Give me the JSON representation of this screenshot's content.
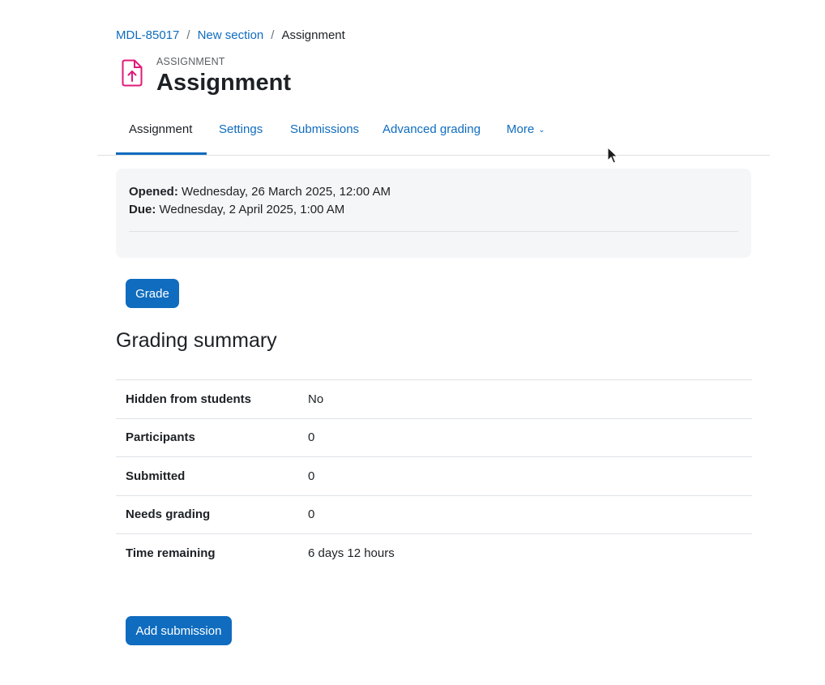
{
  "breadcrumb": {
    "items": [
      "MDL-85017",
      "New section"
    ],
    "current": "Assignment",
    "separator": "/"
  },
  "header": {
    "pretitle": "ASSIGNMENT",
    "title": "Assignment",
    "icon": "assignment-upload-icon",
    "icon_color": "#e1197a"
  },
  "tabs": [
    {
      "label": "Assignment",
      "active": true
    },
    {
      "label": "Settings"
    },
    {
      "label": "Submissions"
    },
    {
      "label": "Advanced grading"
    },
    {
      "label": "More"
    }
  ],
  "dates": {
    "opened_label": "Opened:",
    "opened_value": "Wednesday, 26 March 2025, 12:00 AM",
    "due_label": "Due:",
    "due_value": "Wednesday, 2 April 2025, 1:00 AM"
  },
  "buttons": {
    "grade": "Grade",
    "add_submission": "Add submission"
  },
  "grading_summary": {
    "title": "Grading summary",
    "rows": [
      {
        "label": "Hidden from students",
        "value": "No"
      },
      {
        "label": "Participants",
        "value": "0"
      },
      {
        "label": "Submitted",
        "value": "0"
      },
      {
        "label": "Needs grading",
        "value": "0"
      },
      {
        "label": "Time remaining",
        "value": "6 days 12 hours"
      }
    ]
  },
  "colors": {
    "primary": "#0f6cbf",
    "text": "#1d2125",
    "box_bg": "#f5f6f7",
    "border": "#dee2e6"
  }
}
